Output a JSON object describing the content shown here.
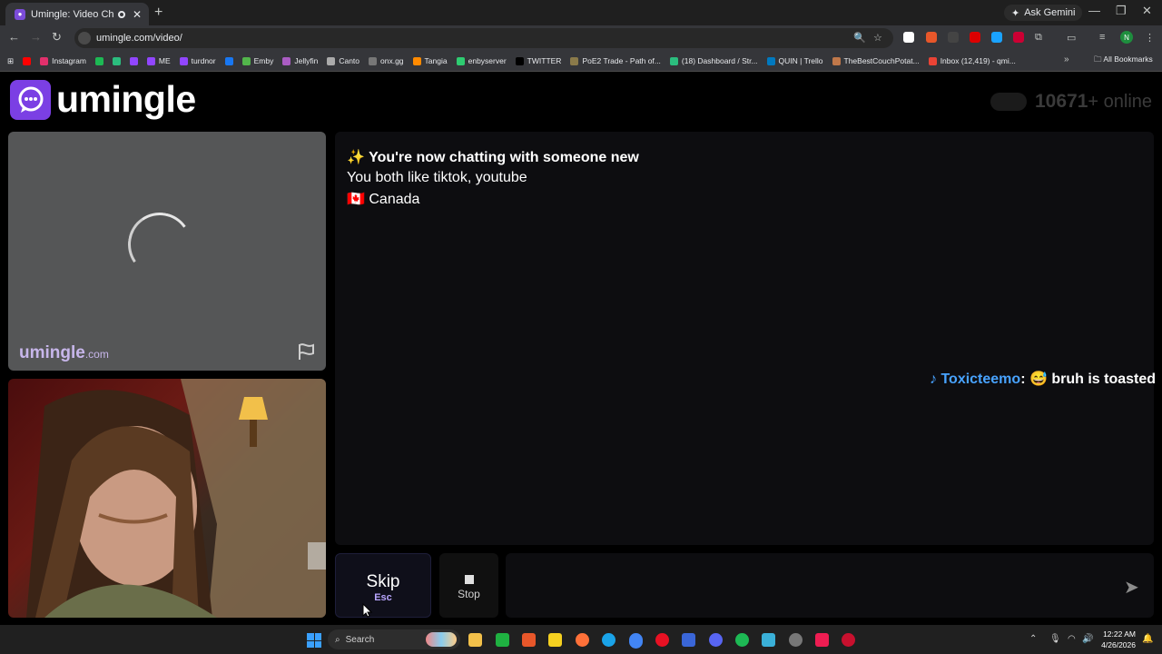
{
  "browser": {
    "tab_title": "Umingle: Video Chat with S",
    "new_tab": "+",
    "ask_gemini": "Ask Gemini",
    "url": "umingle.com/video/",
    "bookmarks": [
      {
        "label": "",
        "color": "#ff0000"
      },
      {
        "label": "Instagram",
        "color": "#e1306c"
      },
      {
        "label": "",
        "color": "#1db954"
      },
      {
        "label": "",
        "color": "#2bbd7e"
      },
      {
        "label": "",
        "color": "#9146ff"
      },
      {
        "label": "ME",
        "color": "#9146ff"
      },
      {
        "label": "turdnor",
        "color": "#9146ff"
      },
      {
        "label": "",
        "color": "#1877f2"
      },
      {
        "label": "Emby",
        "color": "#52b54b"
      },
      {
        "label": "Jellyfin",
        "color": "#aa5cc3"
      },
      {
        "label": "Canto",
        "color": "#aaaaaa"
      },
      {
        "label": "onx.gg",
        "color": "#777777"
      },
      {
        "label": "Tangia",
        "color": "#ff8a00"
      },
      {
        "label": "enbyserver",
        "color": "#2ecc71"
      },
      {
        "label": "TWITTER",
        "color": "#000000"
      },
      {
        "label": "PoE2 Trade - Path of...",
        "color": "#8a7a4a"
      },
      {
        "label": "(18) Dashboard / Str...",
        "color": "#2bbd7e"
      },
      {
        "label": "QUIN | Trello",
        "color": "#0079bf"
      },
      {
        "label": "TheBestCouchPotat...",
        "color": "#c0784a"
      },
      {
        "label": "Inbox (12,419) - qmi...",
        "color": "#ea4335"
      }
    ],
    "all_bookmarks": "All Bookmarks"
  },
  "header": {
    "logo_text": "umingle",
    "online_count": "10671",
    "online_suffix": "+ online"
  },
  "video": {
    "watermark_main": "umingle",
    "watermark_suffix": ".com"
  },
  "chat": {
    "system_line1": "✨ You're now chatting with someone new",
    "system_line2": "You both like tiktok, youtube",
    "system_line3": "🇨🇦 Canada",
    "message": {
      "icon": "♪",
      "username": "Toxicteemo",
      "separator": ":",
      "emoji": "😅",
      "text": "bruh is toasted"
    }
  },
  "controls": {
    "skip_label": "Skip",
    "skip_key": "Esc",
    "stop_label": "Stop",
    "send_icon": "send-icon"
  },
  "taskbar": {
    "search_label": "Search",
    "time": "12:22 AM",
    "date": "4/26/2026"
  },
  "colors": {
    "accent": "#7b3fe4",
    "username": "#48a3ff"
  }
}
